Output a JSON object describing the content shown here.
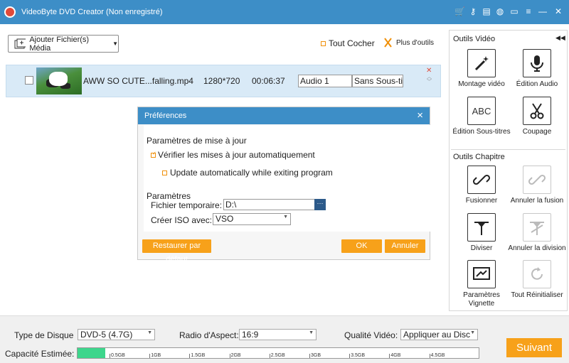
{
  "window": {
    "title": "VideoByte DVD Creator (Non enregistré)"
  },
  "toolbar": {
    "add_label": "Ajouter Fichier(s) Média",
    "check_all": "Tout Cocher",
    "more_tools": "Plus d'outils"
  },
  "file": {
    "name": "AWW SO CUTE...falling.mp4",
    "resolution": "1280*720",
    "duration": "00:06:37",
    "audio": "Audio 1",
    "subtitle": "Sans Sous-tit"
  },
  "dialog": {
    "title": "Préférences",
    "update_section": "Paramètres de mise à jour",
    "opt_check_updates": "Vérifier les mises à jour automatiquement",
    "opt_update_exit": "Update automatically while exiting program",
    "params_section": "Paramètres",
    "temp_label": "Fichier temporaire:",
    "temp_value": "D:\\",
    "iso_label": "Créer ISO avec:",
    "iso_value": "VSO",
    "restore": "Restaurer par défaut",
    "ok": "OK",
    "cancel": "Annuler"
  },
  "panel": {
    "video_tools": "Outils Vidéo",
    "chapter_tools": "Outils Chapitre",
    "montage": "Montage vidéo",
    "audio_edit": "Édition Audio",
    "sub_edit": "Édition Sous-titres",
    "cut": "Coupage",
    "merge": "Fusionner",
    "unmerge": "Annuler la fusion",
    "split": "Diviser",
    "unsplit": "Annuler la division",
    "thumb": "Paramètres Vignette",
    "reset": "Tout Réinitialiser",
    "abc": "ABC"
  },
  "bottom": {
    "disc_label": "Type de Disque",
    "disc_value": "DVD-5 (4.7G)",
    "aspect_label": "Radio d'Aspect:",
    "aspect_value": "16:9",
    "quality_label": "Qualité Vidéo:",
    "quality_value": "Appliquer au Disc",
    "capacity_label": "Capacité Estimée:",
    "capacity_fraction": 0.07,
    "ticks": [
      "0.5GB",
      "1GB",
      "1.5GB",
      "2GB",
      "2.5GB",
      "3GB",
      "3.5GB",
      "4GB",
      "4.5GB"
    ],
    "next": "Suivant"
  },
  "colors": {
    "accent": "#3d8ec7",
    "orange": "#f7a11a",
    "capacity": "#3dd68c"
  }
}
